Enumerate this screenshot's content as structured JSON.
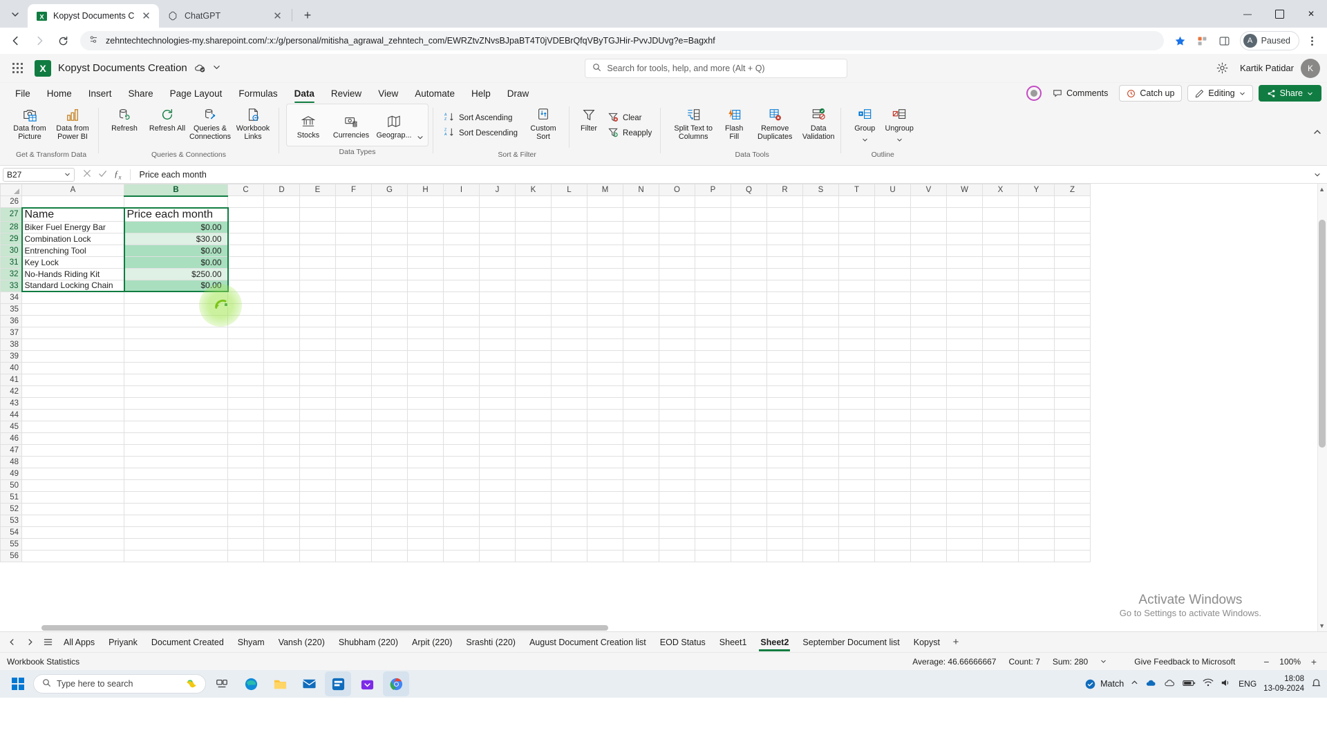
{
  "browser": {
    "tabs": [
      {
        "title": "Kopyst Documents Creation.xls",
        "favicon": "excel-icon",
        "active": true
      },
      {
        "title": "ChatGPT",
        "favicon": "chatgpt-icon",
        "active": false
      }
    ],
    "new_tab_label": "+",
    "url": "zehntechtechnologies-my.sharepoint.com/:x:/g/personal/mitisha_agrawal_zehntech_com/EWRZtvZNvsBJpaBT4T0jVDEBrQfqVByTGJHir-PvvJDUvg?e=Bagxhf",
    "profile_label": "Paused",
    "profile_initial": "A",
    "window_controls": {
      "minimize": "—",
      "maximize": "☐",
      "close": "✕"
    }
  },
  "app_header": {
    "logo_letter": "X",
    "doc_title": "Kopyst Documents Creation",
    "search_placeholder": "Search for tools, help, and more (Alt + Q)",
    "user_name": "Kartik Patidar",
    "user_initial": "K"
  },
  "ribbon_tabs": {
    "items": [
      "File",
      "Home",
      "Insert",
      "Share",
      "Page Layout",
      "Formulas",
      "Data",
      "Review",
      "View",
      "Automate",
      "Help",
      "Draw"
    ],
    "active": "Data",
    "comments_label": "Comments",
    "catchup_label": "Catch up",
    "editing_label": "Editing",
    "share_label": "Share"
  },
  "ribbon": {
    "groups": [
      {
        "label": "Get & Transform Data",
        "buttons": [
          {
            "label": "Data from Picture",
            "icon": "camera-table-icon"
          },
          {
            "label": "Data from Power BI",
            "icon": "bar-chart-icon"
          }
        ]
      },
      {
        "label": "Queries & Connections",
        "buttons": [
          {
            "label": "Refresh",
            "icon": "refresh-db-icon"
          },
          {
            "label": "Refresh All",
            "icon": "refresh-all-icon"
          },
          {
            "label": "Queries & Connections",
            "icon": "db-plug-icon"
          },
          {
            "label": "Workbook Links",
            "icon": "workbook-link-icon"
          }
        ]
      },
      {
        "label": "Data Types",
        "buttons": [
          {
            "label": "Stocks",
            "icon": "bank-icon"
          },
          {
            "label": "Currencies",
            "icon": "currency-icon"
          },
          {
            "label": "Geograp...",
            "icon": "map-icon"
          }
        ]
      },
      {
        "label": "Sort & Filter",
        "buttons": [
          {
            "label": "Sort Ascending",
            "icon": "sort-az-icon"
          },
          {
            "label": "Sort Descending",
            "icon": "sort-za-icon"
          },
          {
            "label": "Custom Sort",
            "icon": "custom-sort-icon"
          },
          {
            "label": "Filter",
            "icon": "funnel-icon"
          },
          {
            "label": "Clear",
            "icon": "clear-filter-icon"
          },
          {
            "label": "Reapply",
            "icon": "reapply-icon"
          }
        ]
      },
      {
        "label": "Data Tools",
        "buttons": [
          {
            "label": "Split Text to Columns",
            "icon": "split-columns-icon"
          },
          {
            "label": "Flash Fill",
            "icon": "flash-fill-icon"
          },
          {
            "label": "Remove Duplicates",
            "icon": "remove-duplicates-icon"
          },
          {
            "label": "Data Validation",
            "icon": "data-validation-icon"
          }
        ]
      },
      {
        "label": "Outline",
        "buttons": [
          {
            "label": "Group",
            "icon": "group-icon"
          },
          {
            "label": "Ungroup",
            "icon": "ungroup-icon"
          }
        ]
      }
    ]
  },
  "formula_bar": {
    "name_box": "B27",
    "formula": "Price each month",
    "cancel_icon": "close-icon",
    "enter_icon": "check-icon",
    "fx_icon": "fx-icon"
  },
  "grid": {
    "columns": [
      "A",
      "B",
      "C",
      "D",
      "E",
      "F",
      "G",
      "H",
      "I",
      "J",
      "K",
      "L",
      "M",
      "N",
      "O",
      "P",
      "Q",
      "R",
      "S",
      "T",
      "U",
      "V",
      "W",
      "X",
      "Y",
      "Z"
    ],
    "selected_column": "B",
    "first_visible_row": 26,
    "last_visible_row": 56,
    "selected_rows": [
      27,
      28,
      29,
      30,
      31,
      32,
      33
    ],
    "data": [
      {
        "row": 27,
        "a": "Name",
        "b": "Price each month",
        "style": "header"
      },
      {
        "row": 28,
        "a": "Biker Fuel Energy Bar",
        "b": "$0.00",
        "style": "dark"
      },
      {
        "row": 29,
        "a": "Combination Lock",
        "b": "$30.00",
        "style": "light"
      },
      {
        "row": 30,
        "a": "Entrenching Tool",
        "b": "$0.00",
        "style": "dark"
      },
      {
        "row": 31,
        "a": "Key Lock",
        "b": "$0.00",
        "style": "dark"
      },
      {
        "row": 32,
        "a": "No-Hands Riding Kit",
        "b": "$250.00",
        "style": "light"
      },
      {
        "row": 33,
        "a": "Standard Locking Chain",
        "b": "$0.00",
        "style": "dark"
      }
    ],
    "watermark_line1": "Activate Windows",
    "watermark_line2": "Go to Settings to activate Windows."
  },
  "sheet_tabs": {
    "items": [
      "All Apps",
      "Priyank",
      "Document Created",
      "Shyam",
      "Vansh (220)",
      "Shubham (220)",
      "Arpit (220)",
      "Srashti (220)",
      "August Document Creation list",
      "EOD Status",
      "Sheet1",
      "Sheet2",
      "September Document list",
      "Kopyst"
    ],
    "active": "Sheet2",
    "add_label": "+"
  },
  "status_bar": {
    "workbook_statistics": "Workbook Statistics",
    "average": "Average: 46.66666667",
    "count": "Count: 7",
    "sum": "Sum: 280",
    "feedback": "Give Feedback to Microsoft",
    "zoom": "100%",
    "zoom_out": "−",
    "zoom_in": "+"
  },
  "taskbar": {
    "search_placeholder": "Type here to search",
    "match_label": "Match",
    "language": "ENG",
    "time": "18:08",
    "date": "13-09-2024",
    "apps": [
      "start-icon",
      "search-icon",
      "copilot-icon",
      "task-view-icon",
      "edge-icon",
      "file-explorer-icon",
      "mail-icon",
      "kopyst-icon",
      "store-icon",
      "chrome-icon"
    ]
  },
  "colors": {
    "excel_green": "#107c41",
    "cell_green_dark": "#a9dfbf",
    "cell_green_light": "#dff0e4",
    "browser_chrome": "#dee1e6",
    "accent_blue": "#0078d4"
  }
}
